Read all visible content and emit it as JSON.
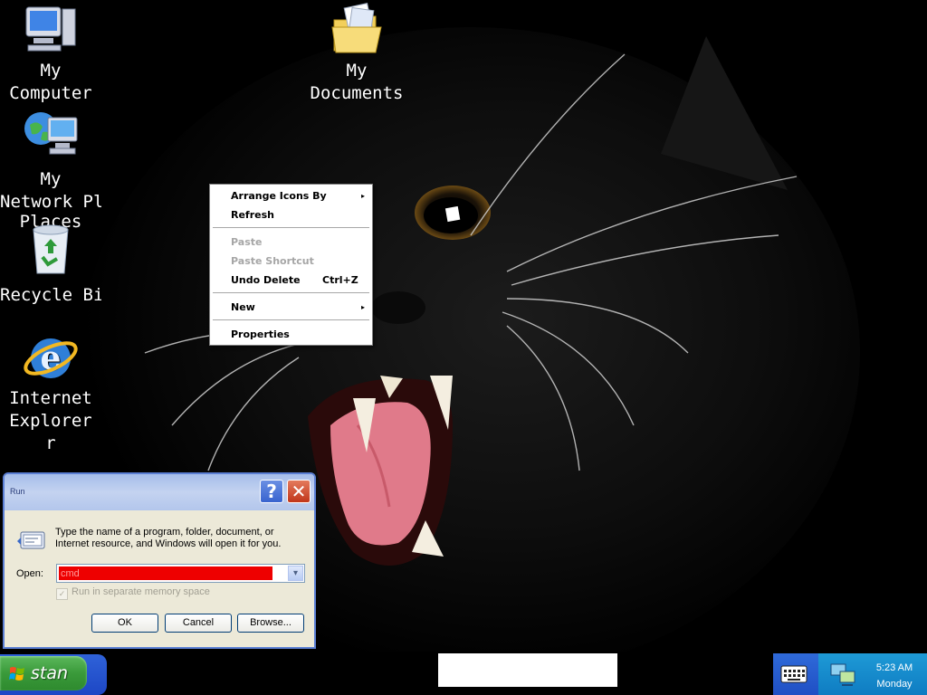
{
  "desktop": {
    "icons": [
      {
        "label1": "My",
        "label2": "Computer",
        "icon": "my-computer-icon"
      },
      {
        "label1": "My",
        "label2": "Documents",
        "icon": "my-documents-icon"
      },
      {
        "label1": "My",
        "label2": "Network Pl...",
        "label3": "Places",
        "icon": "network-places-icon"
      },
      {
        "label1": "Recycle Bin",
        "icon": "recycle-bin-icon"
      },
      {
        "label1": "Internet",
        "label2": "Explorer",
        "label3": "r",
        "icon": "internet-explorer-icon"
      }
    ]
  },
  "context_menu": {
    "items": [
      {
        "label": "Arrange Icons By",
        "submenu": true,
        "enabled": true
      },
      {
        "label": "Refresh",
        "enabled": true
      },
      {
        "label": "Paste",
        "enabled": false
      },
      {
        "label": "Paste Shortcut",
        "enabled": false
      },
      {
        "label": "Undo Delete",
        "shortcut": "Ctrl+Z",
        "enabled": true
      },
      {
        "label": "New",
        "submenu": true,
        "enabled": true
      },
      {
        "label": "Properties",
        "enabled": true
      }
    ],
    "arrow": "▸"
  },
  "run_dialog": {
    "title": "Run",
    "help_glyph": "?",
    "close_glyph": "✕",
    "description": "Type the name of a program, folder, document, or Internet resource, and Windows will open it for you.",
    "open_label": "Open:",
    "open_value": "cmd",
    "dropdown_glyph": "▾",
    "checkbox_label": "Run in separate memory space",
    "checkbox_glyph": "✓",
    "checkbox_checked": true,
    "ok_label": "OK",
    "cancel_label": "Cancel",
    "browse_label": "Browse..."
  },
  "taskbar": {
    "start_label": "stan",
    "clock_time": "5:23 AM",
    "clock_day": "Monday"
  },
  "colors": {
    "start_green": "#3a9a3a",
    "taskbar_blue": "#1f4fc4",
    "tray_blue": "#0f7cc2",
    "input_red": "#ee0000"
  }
}
